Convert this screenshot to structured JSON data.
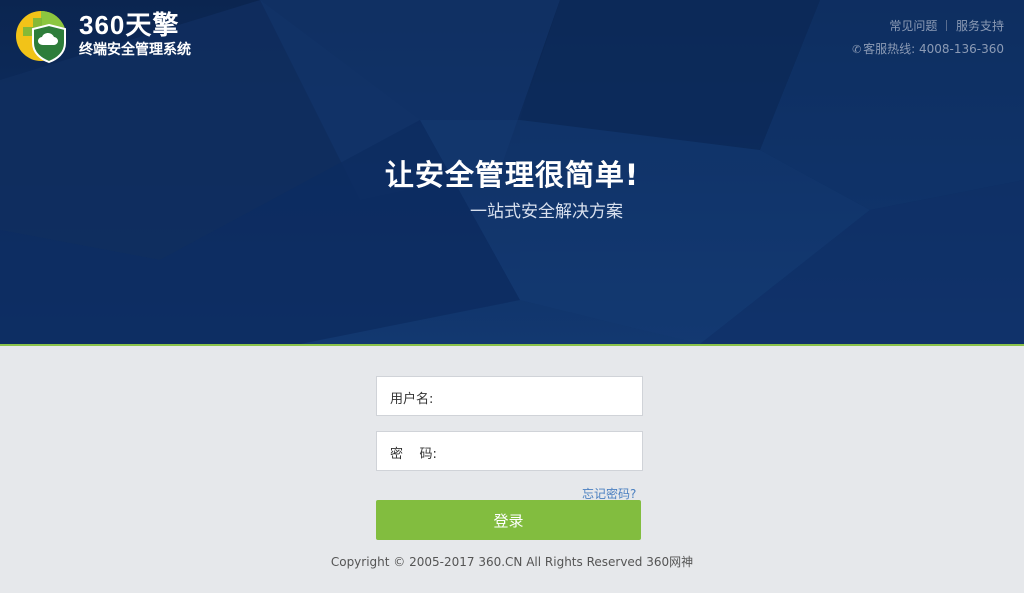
{
  "brand": {
    "title": "360天擎",
    "subtitle": "终端安全管理系统"
  },
  "header": {
    "links": [
      {
        "label": "常见问题"
      },
      {
        "label": "服务支持"
      }
    ],
    "hotline_label": "客服热线:",
    "hotline_number": "4008-136-360",
    "phone_icon": "phone-icon"
  },
  "hero": {
    "slogan": "让安全管理很简单!",
    "tagline": "一站式安全解决方案"
  },
  "login": {
    "username_label": "用户名:",
    "username_value": "",
    "password_label": "密    码:",
    "password_value": "",
    "forgot_label": "忘记密码?",
    "submit_label": "登录"
  },
  "footer": {
    "copyright": "Copyright © 2005-2017 360.CN All Rights Reserved 360网神"
  },
  "colors": {
    "hero_bg": "#0e2f63",
    "accent_green": "#82bd3f",
    "link_blue": "#4a7fc0",
    "page_bg": "#e6e8eb"
  }
}
